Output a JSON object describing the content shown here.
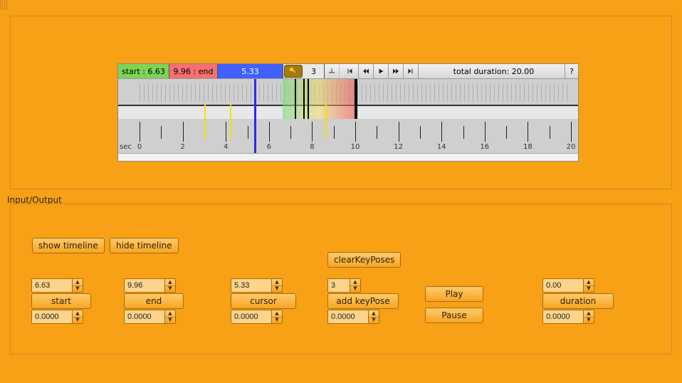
{
  "colors": {
    "bg": "#f8a016",
    "btn_face": "#f6a522",
    "start_box": "#7bd555",
    "end_box": "#f76f6f",
    "cursor_box": "#4060ff"
  },
  "timeline": {
    "start_label": "start : 6.63",
    "end_label": "9.96 : end",
    "cursor_label": "5.33",
    "keypose_count": "3",
    "total_duration_label": "total duration: 20.00",
    "help_label": "?",
    "axis_unit": "sec",
    "axis_ticks": [
      "0",
      "2",
      "4",
      "6",
      "8",
      "10",
      "12",
      "14",
      "16",
      "18",
      "20"
    ],
    "duration_seconds": 20.0,
    "start": 6.63,
    "end": 9.96,
    "cursor": 5.33,
    "keypose_markers": [
      3.0,
      4.2,
      8.6
    ],
    "extra_black_marks": [
      7.2,
      7.6,
      7.8
    ]
  },
  "section_label": "Input/Output",
  "controls": {
    "show_timeline": "show timeline",
    "hide_timeline": "hide timeline",
    "clear_keyposes": "clearKeyPoses",
    "start": {
      "label": "start",
      "value": "6.63",
      "delta": "0.0000"
    },
    "end": {
      "label": "end",
      "value": "9.96",
      "delta": "0.0000"
    },
    "cursor": {
      "label": "cursor",
      "value": "5.33",
      "delta": "0.0000"
    },
    "keypose": {
      "label": "add keyPose",
      "value": "3",
      "delta": "0.0000"
    },
    "play": "Play",
    "pause": "Pause",
    "duration": {
      "label": "duration",
      "value": "0.00",
      "delta": "0.0000"
    }
  }
}
